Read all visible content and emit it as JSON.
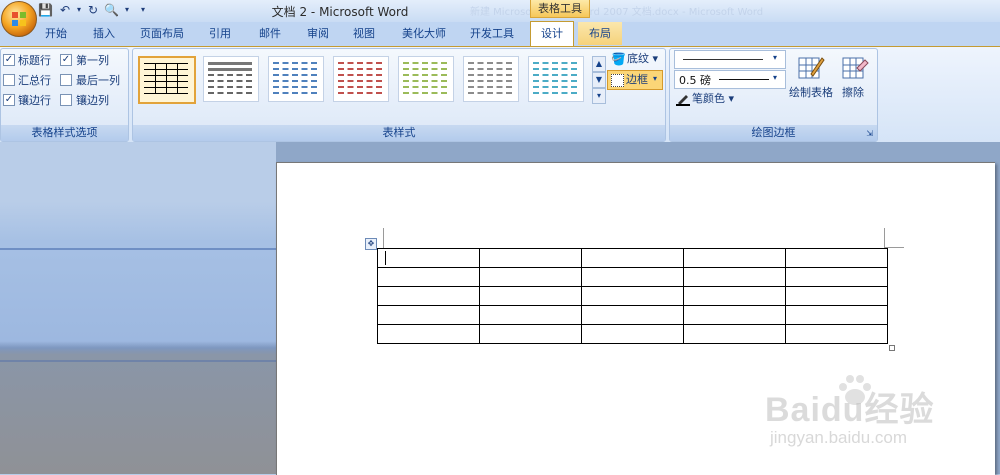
{
  "window": {
    "title": "文档 2 - Microsoft Word",
    "context_tab_group": "表格工具",
    "background_title_ghost": "新建 Microsoft Office Word 2007 文档.docx - Microsoft Word"
  },
  "tabs": [
    {
      "label": "开始",
      "active": false,
      "contextual": false
    },
    {
      "label": "插入",
      "active": false,
      "contextual": false
    },
    {
      "label": "页面布局",
      "active": false,
      "contextual": false
    },
    {
      "label": "引用",
      "active": false,
      "contextual": false
    },
    {
      "label": "邮件",
      "active": false,
      "contextual": false
    },
    {
      "label": "审阅",
      "active": false,
      "contextual": false
    },
    {
      "label": "视图",
      "active": false,
      "contextual": false
    },
    {
      "label": "美化大师",
      "active": false,
      "contextual": false
    },
    {
      "label": "开发工具",
      "active": false,
      "contextual": false
    },
    {
      "label": "设计",
      "active": true,
      "contextual": true
    },
    {
      "label": "布局",
      "active": false,
      "contextual": true
    }
  ],
  "groups": {
    "style_options": {
      "label": "表格样式选项",
      "checks": [
        {
          "label": "标题行",
          "checked": true
        },
        {
          "label": "第一列",
          "checked": true
        },
        {
          "label": "汇总行",
          "checked": false
        },
        {
          "label": "最后一列",
          "checked": false
        },
        {
          "label": "镶边行",
          "checked": true
        },
        {
          "label": "镶边列",
          "checked": false
        }
      ]
    },
    "table_styles": {
      "label": "表样式",
      "thumb_colors": [
        "#000000",
        "#666666",
        "#4f81bd",
        "#c0504d",
        "#9bbb59",
        "#8c8c8c",
        "#4bacc6"
      ],
      "shading_label": "底纹",
      "borders_label": "边框"
    },
    "draw_borders": {
      "label": "绘图边框",
      "line_weight": "0.5 磅",
      "pen_color_label": "笔颜色",
      "draw_table_label": "绘制表格",
      "erase_label": "擦除"
    }
  },
  "document": {
    "table": {
      "rows": 5,
      "cols": 5
    }
  },
  "watermark": {
    "main": "Baidu经验",
    "sub": "jingyan.baidu.com"
  }
}
